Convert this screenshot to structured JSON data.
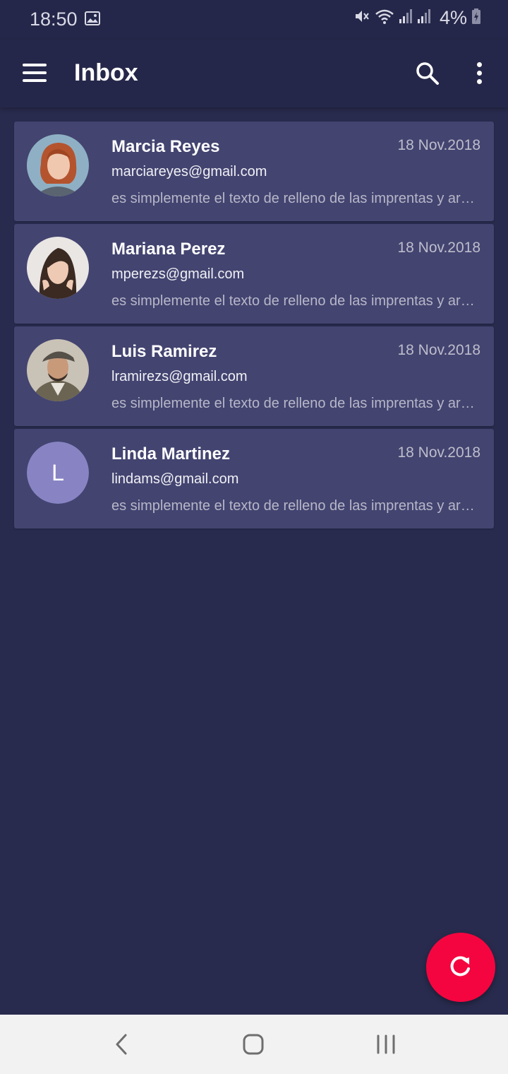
{
  "status_bar": {
    "time": "18:50",
    "battery": "4%",
    "icons": [
      "gallery-icon",
      "mute-icon",
      "wifi-icon",
      "signal-icon",
      "signal-icon",
      "battery-charging-icon"
    ]
  },
  "app_bar": {
    "title": "Inbox",
    "icons": [
      "menu-icon",
      "search-icon",
      "more-vert-icon"
    ]
  },
  "colors": {
    "background": "#292b4e",
    "app_bar": "#25274a",
    "card": "#434470",
    "fab": "#f5053f",
    "letter_avatar": "#8884c4"
  },
  "emails": [
    {
      "name": "Marcia Reyes",
      "date": "18 Nov.2018",
      "email": "marciareyes@gmail.com",
      "preview": "es simplemente el texto de relleno de las imprentas y archivos de texto",
      "avatar": "photo"
    },
    {
      "name": "Mariana Perez",
      "date": "18 Nov.2018",
      "email": "mperezs@gmail.com",
      "preview": "es simplemente el texto de relleno de las imprentas y archivos de texto",
      "avatar": "photo"
    },
    {
      "name": "Luis Ramirez",
      "date": "18 Nov.2018",
      "email": "lramirezs@gmail.com",
      "preview": "es simplemente el texto de relleno de las imprentas y archivos de texto",
      "avatar": "photo"
    },
    {
      "name": "Linda Martinez",
      "date": "18 Nov.2018",
      "email": "lindams@gmail.com",
      "preview": "es simplemente el texto de relleno de las imprentas y archivos de texto",
      "avatar": "letter",
      "avatar_letter": "L"
    }
  ],
  "fab": {
    "icon": "refresh-icon"
  },
  "nav_bar": {
    "icons": [
      "back-icon",
      "home-icon",
      "recents-icon"
    ]
  }
}
